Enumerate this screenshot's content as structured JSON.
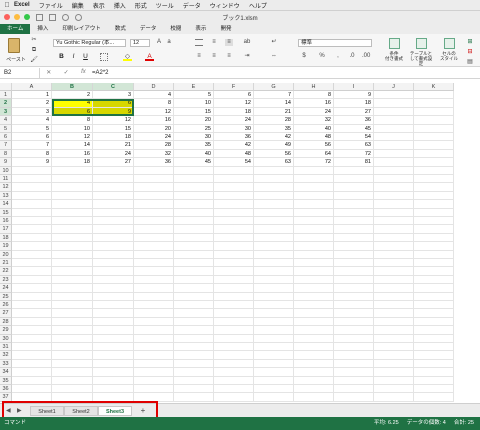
{
  "menubar": {
    "app": "Excel",
    "items": [
      "ファイル",
      "編集",
      "表示",
      "挿入",
      "形式",
      "ツール",
      "データ",
      "ウィンドウ",
      "ヘルプ"
    ]
  },
  "window": {
    "title": "ブック1.xlsm"
  },
  "ribbon": {
    "tabs": [
      "ホーム",
      "挿入",
      "印刷レイアウト",
      "数式",
      "データ",
      "校閲",
      "表示",
      "開発"
    ],
    "active_tab": "ホーム",
    "paste_label": "ペースト",
    "font_name": "Yu Gothic Regular (本...",
    "font_size": "12",
    "number_format": "標準",
    "cond_format_label": "条件\n付き書式",
    "table_format_label": "テーブルと\nして書式設定",
    "cell_style_label": "セルの\nスタイル"
  },
  "formula_bar": {
    "name_box": "B2",
    "fx": "fx",
    "formula": "=A2*2"
  },
  "columns": [
    "A",
    "B",
    "C",
    "D",
    "E",
    "F",
    "G",
    "H",
    "I",
    "J",
    "K"
  ],
  "selected_columns": [
    "B",
    "C"
  ],
  "selected_rows": [
    2,
    3
  ],
  "rows": [
    1,
    2,
    3,
    4,
    5,
    6,
    7,
    8,
    9,
    10,
    11,
    12,
    13,
    14,
    15,
    16,
    17,
    18,
    19,
    20,
    21,
    22,
    23,
    24,
    25,
    26,
    27,
    28,
    29,
    30,
    31,
    32,
    33,
    34,
    35,
    36,
    37
  ],
  "cells": [
    [
      "1",
      "2",
      "3",
      "4",
      "5",
      "6",
      "7",
      "8",
      "9"
    ],
    [
      "2",
      "4",
      "6",
      "8",
      "10",
      "12",
      "14",
      "16",
      "18"
    ],
    [
      "3",
      "6",
      "9",
      "12",
      "15",
      "18",
      "21",
      "24",
      "27"
    ],
    [
      "4",
      "8",
      "12",
      "16",
      "20",
      "24",
      "28",
      "32",
      "36"
    ],
    [
      "5",
      "10",
      "15",
      "20",
      "25",
      "30",
      "35",
      "40",
      "45"
    ],
    [
      "6",
      "12",
      "18",
      "24",
      "30",
      "36",
      "42",
      "48",
      "54"
    ],
    [
      "7",
      "14",
      "21",
      "28",
      "35",
      "42",
      "49",
      "56",
      "63"
    ],
    [
      "8",
      "16",
      "24",
      "32",
      "40",
      "48",
      "56",
      "64",
      "72"
    ],
    [
      "9",
      "18",
      "27",
      "36",
      "45",
      "54",
      "63",
      "72",
      "81"
    ]
  ],
  "sheets": [
    "Sheet1",
    "Sheet2",
    "Sheet3"
  ],
  "active_sheet": "Sheet3",
  "status": {
    "mode": "コマンド",
    "average": "平均: 6.25",
    "count": "データの個数: 4",
    "sum": "合計: 25"
  },
  "colors": {
    "accent": "#1f7244",
    "highlight": "#ffff00",
    "annotation": "#e00000"
  }
}
